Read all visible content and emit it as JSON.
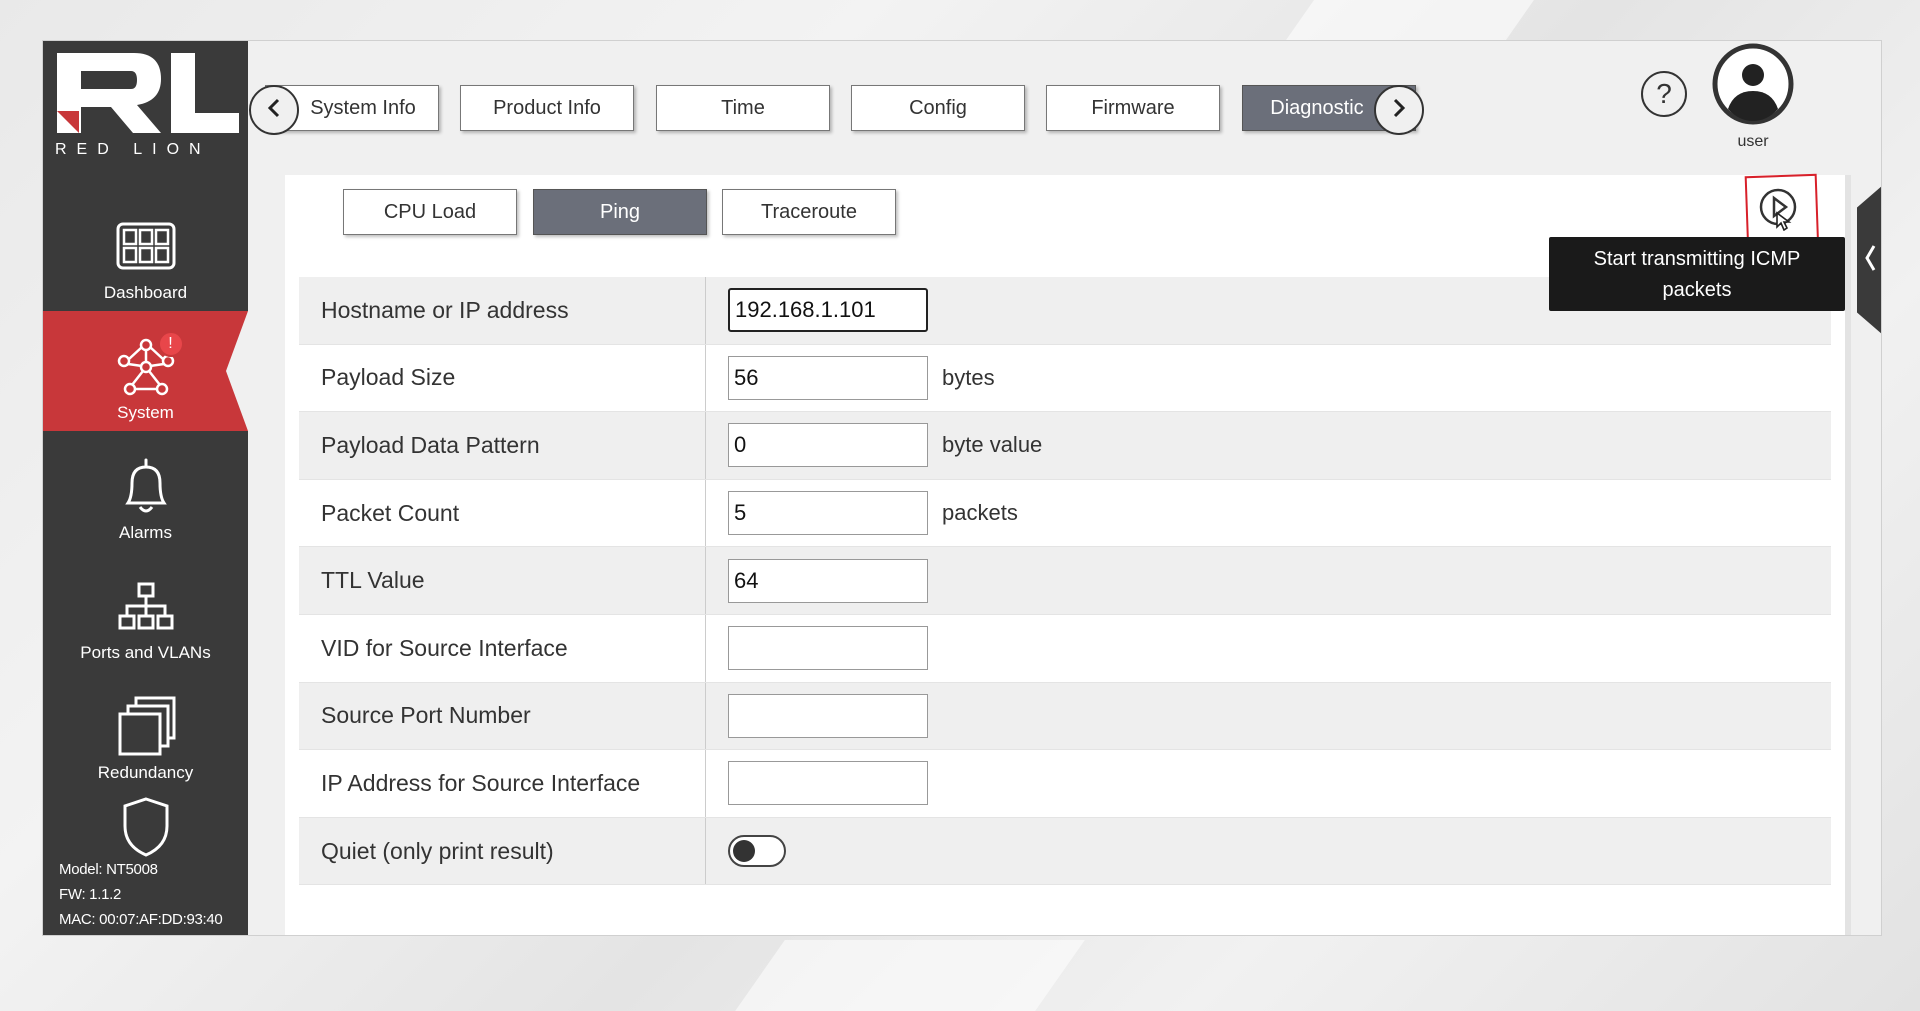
{
  "brand": {
    "logo_text": "RL",
    "brand_name": "RED LION"
  },
  "sidebar": {
    "items": [
      {
        "label": "Dashboard",
        "icon": "dashboard-icon"
      },
      {
        "label": "System",
        "icon": "system-network-icon",
        "badge": "!",
        "active": true
      },
      {
        "label": "Alarms",
        "icon": "bell-icon"
      },
      {
        "label": "Ports and VLANs",
        "icon": "network-topology-icon"
      },
      {
        "label": "Redundancy",
        "icon": "stacked-windows-icon"
      },
      {
        "label": "",
        "icon": "shield-icon"
      }
    ],
    "device": {
      "model": "Model: NT5008",
      "fw": "FW: 1.1.2",
      "mac": "MAC: 00:07:AF:DD:93:40"
    }
  },
  "top_tabs": [
    {
      "label": "System Info"
    },
    {
      "label": "Product Info"
    },
    {
      "label": "Time"
    },
    {
      "label": "Config"
    },
    {
      "label": "Firmware"
    },
    {
      "label": "Diagnostic",
      "active": true
    }
  ],
  "header": {
    "help": "?",
    "user_label": "user"
  },
  "sub_tabs": [
    {
      "label": "CPU Load"
    },
    {
      "label": "Ping",
      "active": true
    },
    {
      "label": "Traceroute"
    }
  ],
  "tooltip": {
    "text_line1": "Start transmitting ICMP",
    "text_line2": "packets"
  },
  "form": {
    "rows": [
      {
        "label": "Hostname or IP address",
        "value": "192.168.1.101",
        "unit": ""
      },
      {
        "label": "Payload Size",
        "value": "56",
        "unit": "bytes"
      },
      {
        "label": "Payload Data Pattern",
        "value": "0",
        "unit": "byte value"
      },
      {
        "label": "Packet Count",
        "value": "5",
        "unit": "packets"
      },
      {
        "label": "TTL Value",
        "value": "64",
        "unit": ""
      },
      {
        "label": "VID for Source Interface",
        "value": "",
        "unit": ""
      },
      {
        "label": "Source Port Number",
        "value": "",
        "unit": ""
      },
      {
        "label": "IP Address for Source Interface",
        "value": "",
        "unit": ""
      }
    ],
    "quiet": {
      "label": "Quiet (only print result)",
      "on": false
    }
  },
  "colors": {
    "sidebar_bg": "#3a3a3a",
    "active_red": "#c8373a",
    "active_tab": "#6b6f7a",
    "highlight": "#d8202a"
  }
}
